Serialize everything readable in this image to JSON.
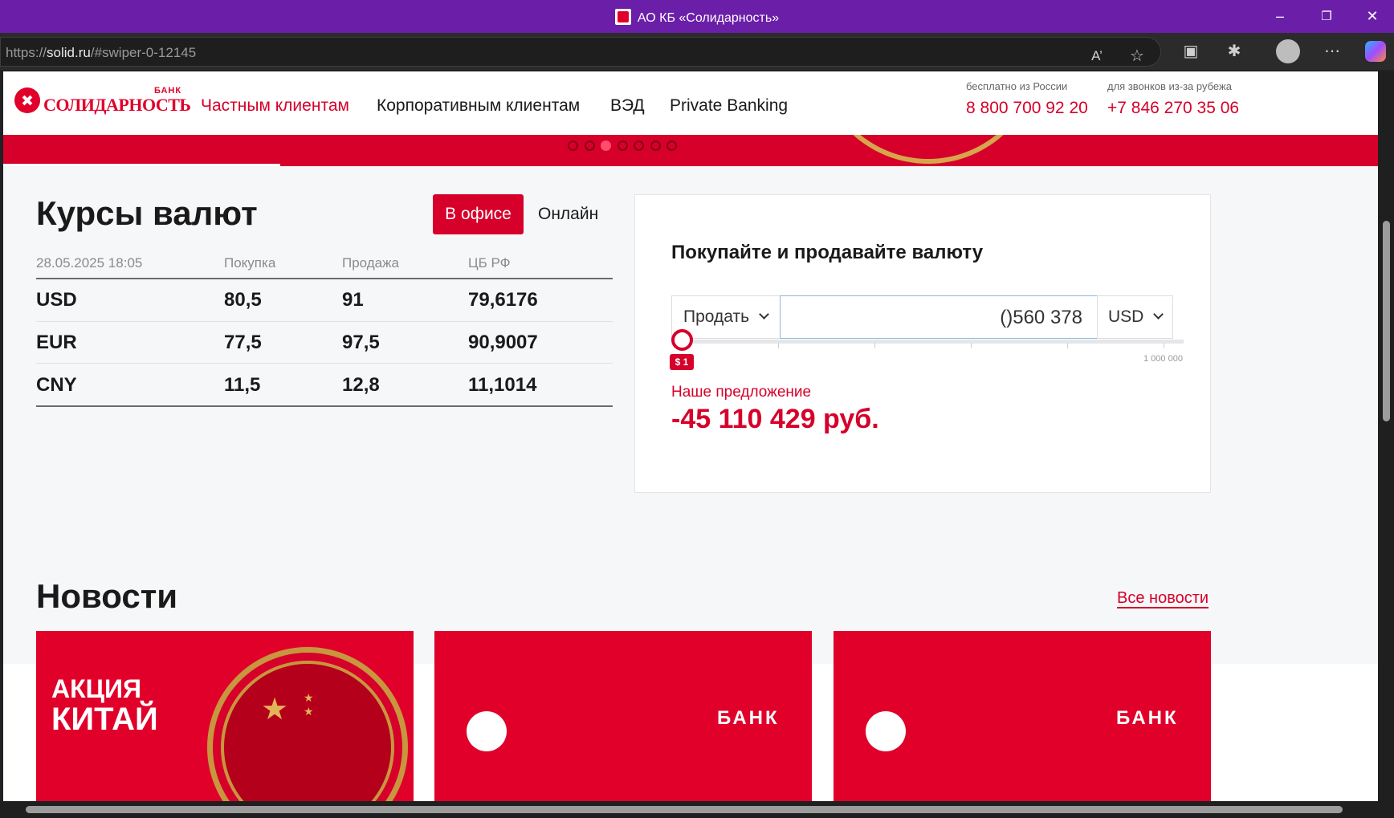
{
  "window": {
    "title": "АО КБ «Солидарность»"
  },
  "address_bar": {
    "scheme": "https://",
    "host": "solid.ru",
    "path": "/#swiper-0-12145"
  },
  "header": {
    "logo_small": "БАНК",
    "logo_name": "СОЛИДАРНОСТЬ",
    "nav": [
      {
        "label": "Частным клиентам",
        "active": true
      },
      {
        "label": "Корпоративным клиентам",
        "active": false
      },
      {
        "label": "ВЭД",
        "active": false
      },
      {
        "label": "Private Banking",
        "active": false
      }
    ],
    "phones": [
      {
        "caption": "бесплатно из России",
        "number": "8 800 700 92 20"
      },
      {
        "caption": "для звонков из-за рубежа",
        "number": "+7 846 270 35 06"
      }
    ]
  },
  "slider": {
    "dot_count": 7,
    "active_index": 2
  },
  "rates": {
    "title": "Курсы валют",
    "tab_office": "В офисе",
    "tab_online": "Онлайн",
    "columns": [
      "28.05.2025 18:05",
      "Покупка",
      "Продажа",
      "ЦБ РФ"
    ],
    "rows": [
      [
        "USD",
        "80,5",
        "91",
        "79,6176"
      ],
      [
        "EUR",
        "77,5",
        "97,5",
        "90,9007"
      ],
      [
        "CNY",
        "11,5",
        "12,8",
        "11,1014"
      ]
    ]
  },
  "exchange": {
    "title": "Покупайте и продавайте валюту",
    "operation": "Продать",
    "amount": "()560 378",
    "currency": "USD",
    "slider_min_label": "$ 1",
    "slider_max_label": "1 000 000",
    "slider_value_fraction": 0.0,
    "offer_caption": "Наше предложение",
    "offer_value": "-45 110 429 руб."
  },
  "news": {
    "title": "Новости",
    "all_link": "Все новости",
    "cards": [
      {
        "line1": "АКЦИЯ",
        "line2": "КИТАЙ"
      },
      {
        "bank_label": "БАНК"
      },
      {
        "bank_label": "БАНК"
      }
    ]
  },
  "colors": {
    "brand": "#d6002a",
    "titlebar": "#6b1fa8"
  }
}
